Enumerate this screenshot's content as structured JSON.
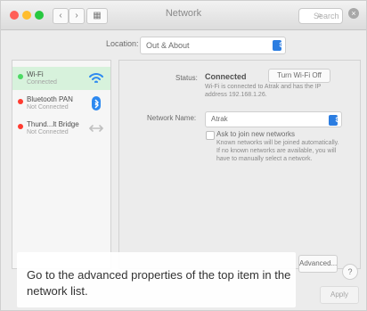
{
  "window": {
    "title": "Network",
    "search_placeholder": "Search"
  },
  "location": {
    "label": "Location:",
    "value": "Out & About"
  },
  "sidebar": {
    "items": [
      {
        "name": "Wi-Fi",
        "status": "Connected",
        "dot_color": "#4cd964"
      },
      {
        "name": "Bluetooth PAN",
        "status": "Not Connected",
        "dot_color": "#ff3b30"
      },
      {
        "name": "Thund...lt Bridge",
        "status": "Not Connected",
        "dot_color": "#ff3b30"
      }
    ]
  },
  "details": {
    "status_label": "Status:",
    "status_value": "Connected",
    "turn_off_button": "Turn Wi-Fi Off",
    "status_desc": "Wi-Fi is connected to Atrak and has the IP address 192.168.1.26.",
    "network_name_label": "Network Name:",
    "network_name_value": "Atrak",
    "ask_join_label": "Ask to join new networks",
    "ask_join_desc": "Known networks will be joined automatically. If no known networks are available, you will have to manually select a network."
  },
  "footer": {
    "advanced_button": "Advanced...",
    "help_button": "?",
    "apply_button": "Apply"
  },
  "instruction": {
    "text": "Go to the advanced properties of the top item in the network list."
  }
}
